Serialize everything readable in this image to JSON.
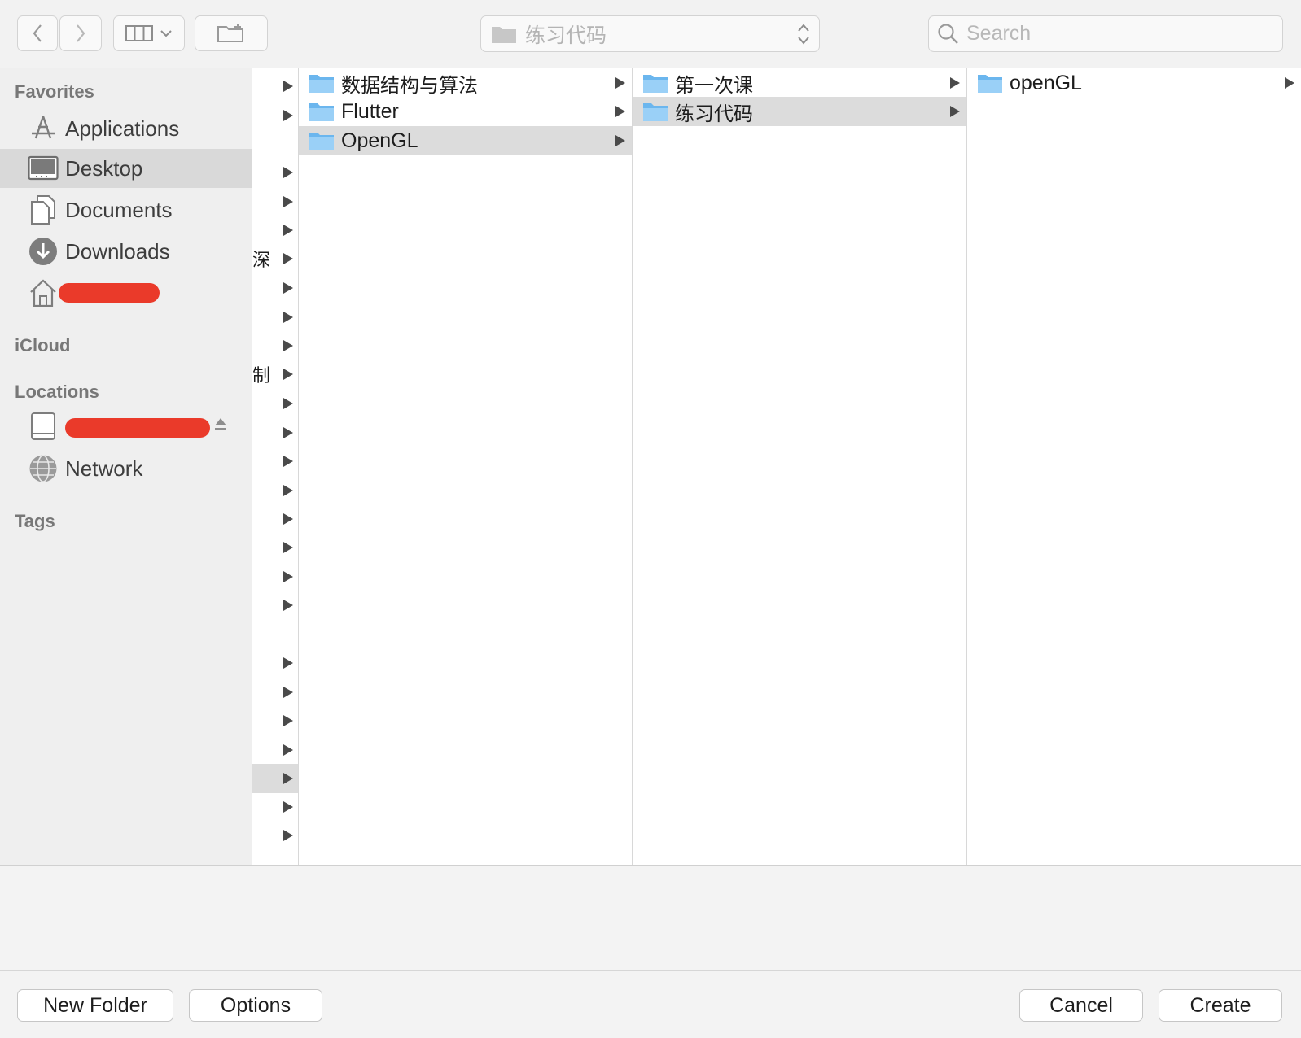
{
  "toolbar": {
    "path_popup_label": "练习代码",
    "search_placeholder": "Search"
  },
  "sidebar": {
    "favorites_header": "Favorites",
    "favorites": [
      {
        "label": "Applications",
        "icon": "applications-icon"
      },
      {
        "label": "Desktop",
        "icon": "desktop-icon",
        "selected": true
      },
      {
        "label": "Documents",
        "icon": "documents-icon"
      },
      {
        "label": "Downloads",
        "icon": "downloads-icon"
      },
      {
        "label": "",
        "icon": "home-icon",
        "redacted": true
      }
    ],
    "icloud_header": "iCloud",
    "locations_header": "Locations",
    "locations": [
      {
        "label": "",
        "icon": "disk-icon",
        "redacted": true,
        "ejectable": true
      },
      {
        "label": "Network",
        "icon": "network-icon"
      }
    ],
    "tags_header": "Tags"
  },
  "column0": {
    "fragments": [
      "深",
      "制"
    ]
  },
  "column1": {
    "items": [
      {
        "label": "数据结构与算法",
        "has_children": true
      },
      {
        "label": "Flutter",
        "has_children": true
      },
      {
        "label": "OpenGL",
        "has_children": true,
        "selected": true
      }
    ]
  },
  "column2": {
    "items": [
      {
        "label": "第一次课",
        "has_children": true
      },
      {
        "label": "练习代码",
        "has_children": true,
        "selected": true
      }
    ]
  },
  "column3": {
    "items": [
      {
        "label": "openGL",
        "has_children": true
      }
    ]
  },
  "footer": {
    "new_folder_label": "New Folder",
    "options_label": "Options",
    "cancel_label": "Cancel",
    "create_label": "Create"
  },
  "colors": {
    "folder_blue": "#6bb6ee",
    "selection_gray": "#dcdcdc",
    "redaction_red": "#ea3a2a"
  }
}
